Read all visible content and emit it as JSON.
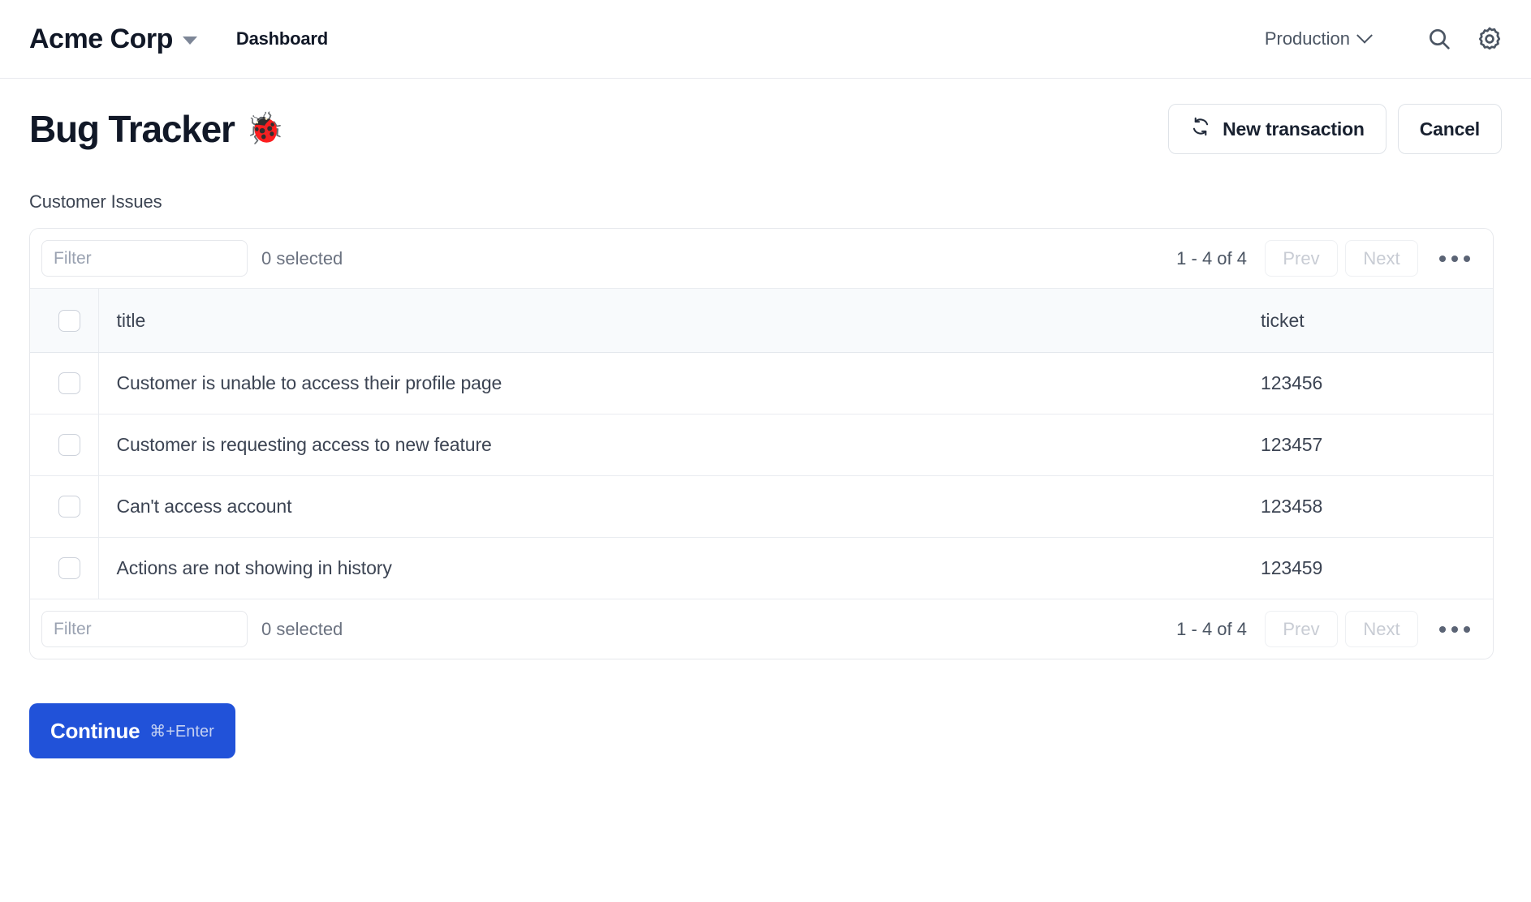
{
  "appbar": {
    "brand": "Acme Corp",
    "brand_caret_icon": "caret-down-icon",
    "nav_link": "Dashboard",
    "environment": "Production",
    "environment_chevron_icon": "chevron-down-icon",
    "search_icon": "search-icon",
    "settings_icon": "gear-icon"
  },
  "header": {
    "title": "Bug Tracker",
    "title_emoji": "🐞",
    "actions": {
      "new_transaction_label": "New transaction",
      "new_transaction_icon": "refresh-icon",
      "cancel_label": "Cancel"
    }
  },
  "section": {
    "label": "Customer Issues"
  },
  "toolbar": {
    "filter_placeholder": "Filter",
    "filter_value": "",
    "selected_count": "0 selected",
    "range": "1 - 4 of 4",
    "prev_label": "Prev",
    "next_label": "Next",
    "overflow_icon": "ellipsis-icon"
  },
  "table": {
    "columns": [
      {
        "key": "title",
        "label": "title"
      },
      {
        "key": "ticket",
        "label": "ticket"
      }
    ],
    "rows": [
      {
        "title": "Customer is unable to access their profile page",
        "ticket": "123456"
      },
      {
        "title": "Customer is requesting access to new feature",
        "ticket": "123457"
      },
      {
        "title": "Can't access account",
        "ticket": "123458"
      },
      {
        "title": "Actions are not showing in history",
        "ticket": "123459"
      }
    ]
  },
  "footer": {
    "continue_label": "Continue",
    "continue_shortcut": "⌘+Enter"
  },
  "colors": {
    "primary": "#2152d9",
    "text": "#3c4453",
    "heading": "#111827",
    "border": "#e6e8ec",
    "header_row_bg": "#f8fafc",
    "muted": "#9aa2b1"
  }
}
